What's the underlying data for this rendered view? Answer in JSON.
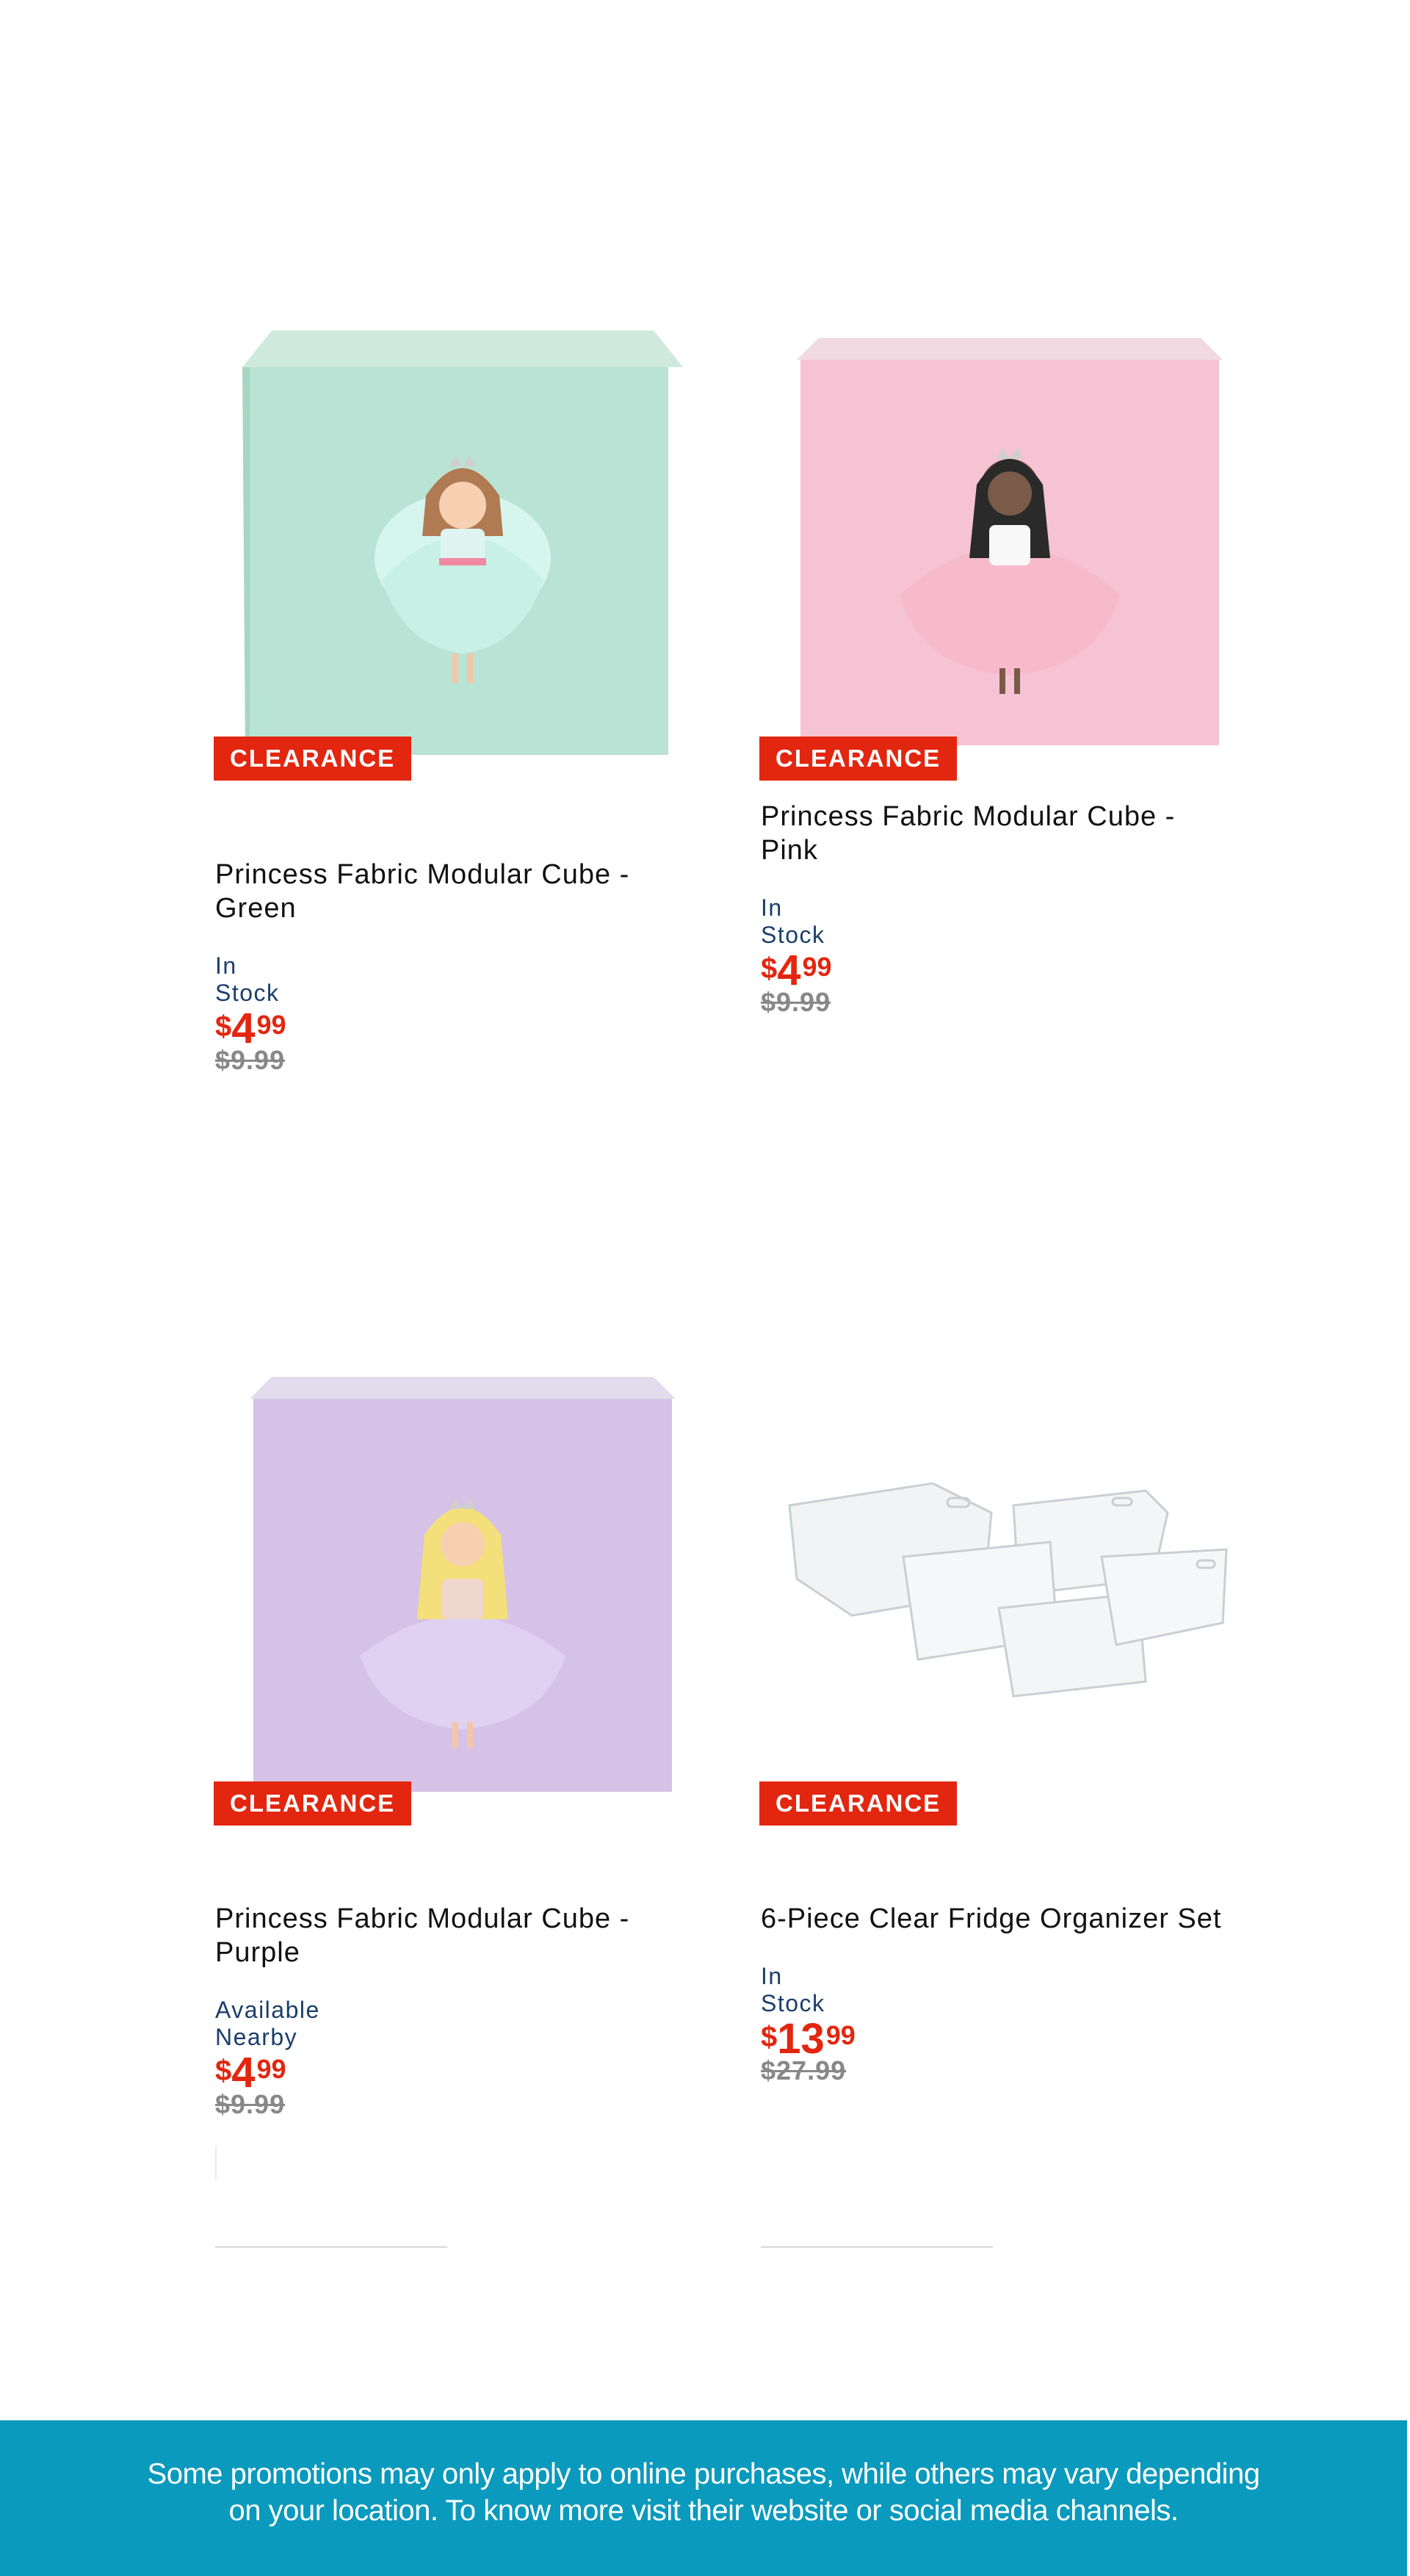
{
  "products": [
    {
      "badge": "CLEARANCE",
      "title": "Princess Fabric Modular Cube - Green",
      "availability": "In Stock",
      "price": {
        "currency": "$",
        "dollars": "4",
        "cents": "99"
      },
      "was_price": "$9.99",
      "image_icon": "green-princess-cube-image",
      "color": "#b9e3d4"
    },
    {
      "badge": "CLEARANCE",
      "title": "Princess Fabric Modular Cube - Pink",
      "availability": "In Stock",
      "price": {
        "currency": "$",
        "dollars": "4",
        "cents": "99"
      },
      "was_price": "$9.99",
      "image_icon": "pink-princess-cube-image",
      "color": "#f5c3d3"
    },
    {
      "badge": "CLEARANCE",
      "title": "Princess Fabric Modular Cube - Purple",
      "availability": "Available Nearby",
      "price": {
        "currency": "$",
        "dollars": "4",
        "cents": "99"
      },
      "was_price": "$9.99",
      "image_icon": "purple-princess-cube-image",
      "color": "#d5c2e6"
    },
    {
      "badge": "CLEARANCE",
      "title": "6-Piece Clear Fridge Organizer Set",
      "availability": "In Stock",
      "price": {
        "currency": "$",
        "dollars": "13",
        "cents": "99"
      },
      "was_price": "$27.99",
      "image_icon": "clear-organizer-set-image",
      "color": "#eef0f1"
    }
  ],
  "footer": {
    "line1": "Some promotions may only apply to online purchases, while others may vary depending",
    "line2": "on your location. To know more visit their website or social media channels."
  },
  "colors": {
    "accent": "#e3260f",
    "availability": "#1a3e6b",
    "footer_bg": "#0a9abd"
  }
}
